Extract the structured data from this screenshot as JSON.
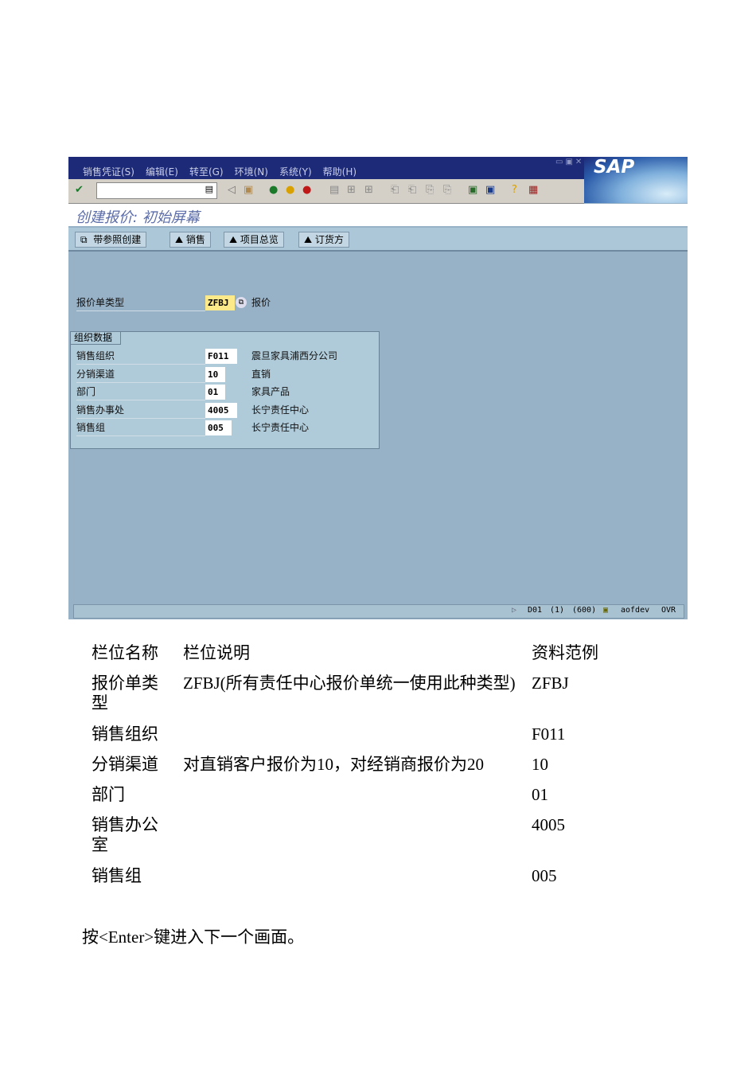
{
  "sap": {
    "menu": [
      "销售凭证(S)",
      "编辑(E)",
      "转至(G)",
      "环境(N)",
      "系统(Y)",
      "帮助(H)"
    ],
    "logo": "SAP",
    "title": "创建报价: 初始屏幕",
    "app_buttons": [
      "带参照创建",
      "销售",
      "项目总览",
      "订货方"
    ],
    "doc_type": {
      "label": "报价单类型",
      "value": "ZFBJ",
      "desc": "报价"
    },
    "group_title": "组织数据",
    "fields": [
      {
        "label": "销售组织",
        "value": "F011",
        "desc": "震旦家具浦西分公司"
      },
      {
        "label": "分销渠道",
        "value": "10",
        "desc": "直销"
      },
      {
        "label": "部门",
        "value": "01",
        "desc": "家具产品"
      },
      {
        "label": "销售办事处",
        "value": "4005",
        "desc": "长宁责任中心"
      },
      {
        "label": "销售组",
        "value": "005",
        "desc": "长宁责任中心"
      }
    ],
    "status": {
      "system": "D01",
      "session": "(1)",
      "client": "(600)",
      "server": "aofdev",
      "mode": "OVR"
    }
  },
  "table": {
    "headers": [
      "栏位名称",
      "栏位说明",
      "资料范例"
    ],
    "rows": [
      [
        "报价单类型",
        "ZFBJ(所有责任中心报价单统一使用此种类型)",
        "ZFBJ"
      ],
      [
        "销售组织",
        "",
        "F011"
      ],
      [
        "分销渠道",
        "对直销客户报价为10，对经销商报价为20",
        "10"
      ],
      [
        "部门",
        "",
        "01"
      ],
      [
        "销售办公室",
        "",
        "4005"
      ],
      [
        "销售组",
        "",
        "005"
      ]
    ]
  },
  "footer_note": "按<Enter>键进入下一个画面。"
}
